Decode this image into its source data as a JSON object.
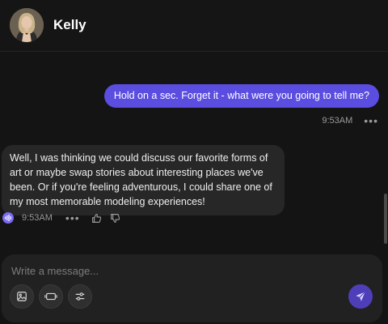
{
  "header": {
    "contact_name": "Kelly",
    "avatar_icon": "avatar-portrait"
  },
  "messages": [
    {
      "role": "user",
      "text": "Hold on a sec. Forget it - what were you going to tell me?",
      "time": "9:53AM",
      "more": "•••"
    },
    {
      "role": "assistant",
      "text": "Well, I was thinking we could discuss our favorite forms of art or maybe swap stories about interesting places we've been. Or if you're feeling adventurous, I could share one of my most memorable modeling experiences!",
      "time": "9:53AM",
      "more": "•••",
      "icons": [
        "voice-icon",
        "thumbs-up-icon",
        "thumbs-down-icon"
      ]
    }
  ],
  "composer": {
    "placeholder": "Write a message...",
    "value": "",
    "tools": [
      "image-icon",
      "video-icon",
      "settings-sliders-icon"
    ],
    "send_icon": "send-icon"
  },
  "colors": {
    "background": "#141414",
    "user_bubble": "#5b4de0",
    "bot_bubble": "#272727",
    "accent": "#7a6cf0",
    "send_button": "#4e3fb8"
  }
}
